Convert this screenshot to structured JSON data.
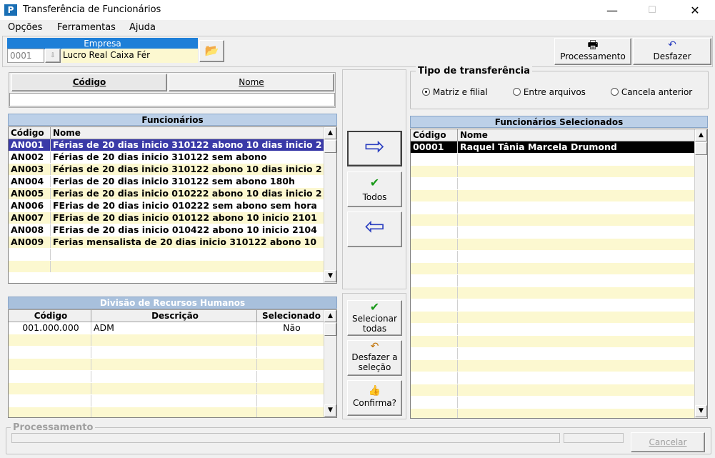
{
  "window": {
    "title": "Transferência de Funcionários",
    "minimize": "—",
    "maximize": "☐",
    "close": "✕",
    "app_icon": "P"
  },
  "menu": [
    "Opções",
    "Ferramentas",
    "Ajuda"
  ],
  "empresa": {
    "header": "Empresa",
    "code": "0001",
    "name": "Lucro Real Caixa Fér",
    "folder_icon": "📂"
  },
  "toolbar": {
    "processamento": "Processamento",
    "desfazer": "Desfazer",
    "proc_icon": "🖶",
    "undo_icon": "↶"
  },
  "search": {
    "tab_codigo": "Código",
    "tab_nome": "Nome",
    "value": ""
  },
  "funcionarios": {
    "title": "Funcionários",
    "col_codigo": "Código",
    "col_nome": "Nome",
    "rows": [
      {
        "codigo": "AN001",
        "nome": "Férias de 20 dias inicio 310122 abono 10 dias inicio 2"
      },
      {
        "codigo": "AN002",
        "nome": "Férias de 20 dias inicio 310122 sem abono"
      },
      {
        "codigo": "AN003",
        "nome": "Férias de 20 dias inicio 310122 abono 10 dias inicio 2"
      },
      {
        "codigo": "AN004",
        "nome": "Ferias de 20 dias inicio 310122 sem abono 180h"
      },
      {
        "codigo": "AN005",
        "nome": "Ferias de 20 dias inicio 010222 abono 10 dias inicio 2"
      },
      {
        "codigo": "AN006",
        "nome": "FErias de 20 dias inicio 010222 sem abono sem hora"
      },
      {
        "codigo": "AN007",
        "nome": "FErias de 20 dias inicio 010122 abono 10 inicio 2101"
      },
      {
        "codigo": "AN008",
        "nome": "FErias de 20 dias inicio 010422 abono 10 inicio 2104"
      },
      {
        "codigo": "AN009",
        "nome": "Ferias mensalista de 20 dias inicio 310122 abono 10"
      }
    ]
  },
  "divisao": {
    "title": "Divisão de Recursos Humanos",
    "col_codigo": "Código",
    "col_descricao": "Descrição",
    "col_selecionado": "Selecionado",
    "rows": [
      {
        "codigo": "001.000.000",
        "descricao": "ADM",
        "selecionado": "Não"
      }
    ]
  },
  "transfer": {
    "title": "Tipo de transferência",
    "options": [
      "Matriz e filial",
      "Entre arquivos",
      "Cancela anterior"
    ],
    "selected": "Matriz e filial"
  },
  "selecionados": {
    "title": "Funcionários Selecionados",
    "col_codigo": "Código",
    "col_nome": "Nome",
    "rows": [
      {
        "codigo": "00001",
        "nome": "Raquel Tânia Marcela Drumond"
      }
    ]
  },
  "buttons": {
    "add_icon": "⇨",
    "todos": "Todos",
    "remove_icon": "⇦",
    "check_icon": "✔",
    "selecionar_todas": "Selecionar todas",
    "desfazer_selecao": "Desfazer a seleção",
    "confirma": "Confirma?",
    "confirma_icon": "👍"
  },
  "processamento": {
    "label": "Processamento",
    "cancelar": "Cancelar"
  },
  "colors": {
    "accent": "#1e7fd8",
    "selected_row": "#3a3aa8",
    "row_yellow": "#fcf8d0",
    "grid_header": "#bcd0e8"
  }
}
